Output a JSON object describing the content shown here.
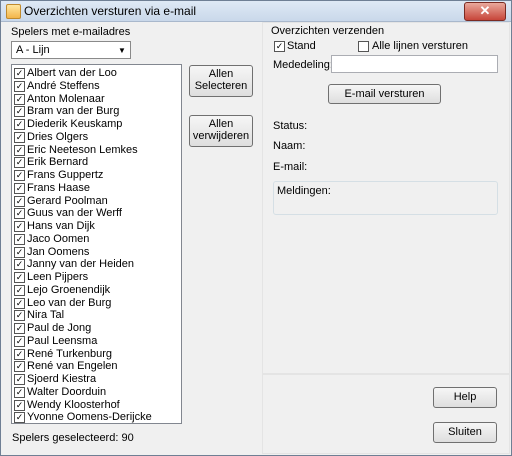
{
  "window": {
    "title": "Overzichten versturen via e-mail",
    "close_glyph": "✕"
  },
  "left": {
    "group_label": "Spelers met e-mailadres",
    "line_select": {
      "value": "A - Lijn",
      "arrow": "▼"
    },
    "players": [
      "Albert van der Loo",
      "André Steffens",
      "Anton Molenaar",
      "Bram van der Burg",
      "Diederik Keuskamp",
      "Dries Olgers",
      "Eric Neeteson Lemkes",
      "Erik Bernard",
      "Frans Guppertz",
      "Frans Haase",
      "Gerard Poolman",
      "Guus van der Werff",
      "Hans van Dijk",
      "Jaco Oomen",
      "Jan Oomens",
      "Janny van der Heiden",
      "Leen Pijpers",
      "Lejo Groenendijk",
      "Leo van der Burg",
      "Nira Tal",
      "Paul de Jong",
      "Paul Leensma",
      "René Turkenburg",
      "René van Engelen",
      "Sjoerd Kiestra",
      "Walter Doorduin",
      "Wendy Kloosterhof",
      "Yvonne Oomens-Derijcke"
    ],
    "check_glyph": "✓",
    "select_all_button": {
      "line1": "Allen",
      "line2": "Selecteren"
    },
    "remove_all_button": {
      "line1": "Allen",
      "line2": "verwijderen"
    },
    "selected_count_text": "Spelers geselecteerd: 90"
  },
  "right": {
    "section_title": "Overzichten verzenden",
    "stand_checkbox": {
      "label": "Stand",
      "checked": true
    },
    "all_lines_checkbox": {
      "label": "Alle lijnen versturen",
      "checked": false
    },
    "message_label": "Mededeling:",
    "message_value": "",
    "send_button": "E-mail versturen",
    "status_label": "Status:",
    "name_label": "Naam:",
    "email_label": "E-mail:",
    "notifications_label": "Meldingen:"
  },
  "footer": {
    "help_button": "Help",
    "close_button": "Sluiten"
  }
}
